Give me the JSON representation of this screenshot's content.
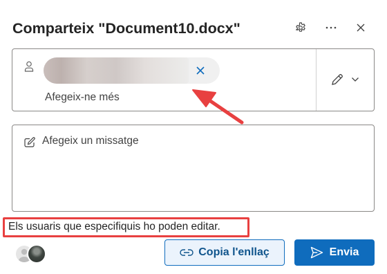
{
  "dialog": {
    "title": "Comparteix \"Document10.docx\"",
    "icons": {
      "settings": "gear-icon",
      "more": "ellipsis-icon",
      "close": "close-icon"
    }
  },
  "recipients": {
    "chip": {
      "name_obscured": true,
      "remove_icon": "close-icon"
    },
    "add_more_placeholder": "Afegeix-ne més",
    "permission_icon": "pencil-icon",
    "permission_dropdown_icon": "chevron-down-icon"
  },
  "message": {
    "placeholder": "Afegeix un missatge"
  },
  "info": {
    "permission_text": "Els usuaris que especifiquis ho poden editar."
  },
  "footer": {
    "copy_link_label": "Copia l'enllaç",
    "send_label": "Envia"
  },
  "colors": {
    "accent": "#0f6cbd",
    "annotation": "#e84040"
  }
}
